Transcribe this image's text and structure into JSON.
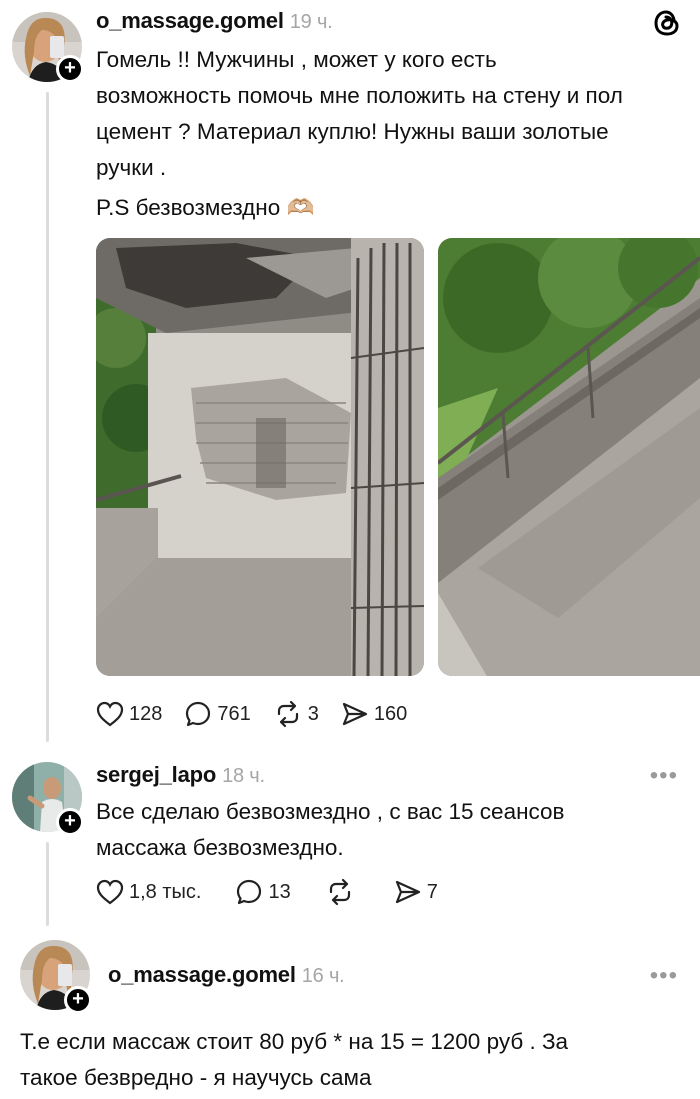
{
  "post": {
    "username": "o_massage.gomel",
    "time": "19 ч.",
    "text_lines": [
      "Гомель !! Мужчины , может у кого есть",
      "возможность помочь мне положить на стену и пол",
      "цемент ? Материал куплю! Нужны ваши золотые",
      "ручки ."
    ],
    "ps_text": "P.S безвозмездно 🫶🏼",
    "likes": "128",
    "comments": "761",
    "reposts": "3",
    "shares": "160",
    "icons": {
      "app_logo": "threads-logo-icon",
      "plus": "follow-plus-icon"
    }
  },
  "reply1": {
    "username": "sergej_lapo",
    "time": "18 ч.",
    "text_lines": [
      "Все сделаю безвозмездно , с вас 15 сеансов",
      "массажа безвозмездно."
    ],
    "likes": "1,8 тыс.",
    "comments": "13",
    "reposts": "",
    "shares": "7",
    "more": "•••"
  },
  "reply2": {
    "username": "o_massage.gomel",
    "time": "16 ч.",
    "text_lines": [
      "Т.е если массаж стоит 80 руб * на 15 = 1200 руб . За",
      "такое безвредно - я научусь сама"
    ],
    "more": "•••"
  },
  "colors": {
    "text": "#111111",
    "muted": "#a6a6a6",
    "thread_line": "#dcdcdc"
  }
}
